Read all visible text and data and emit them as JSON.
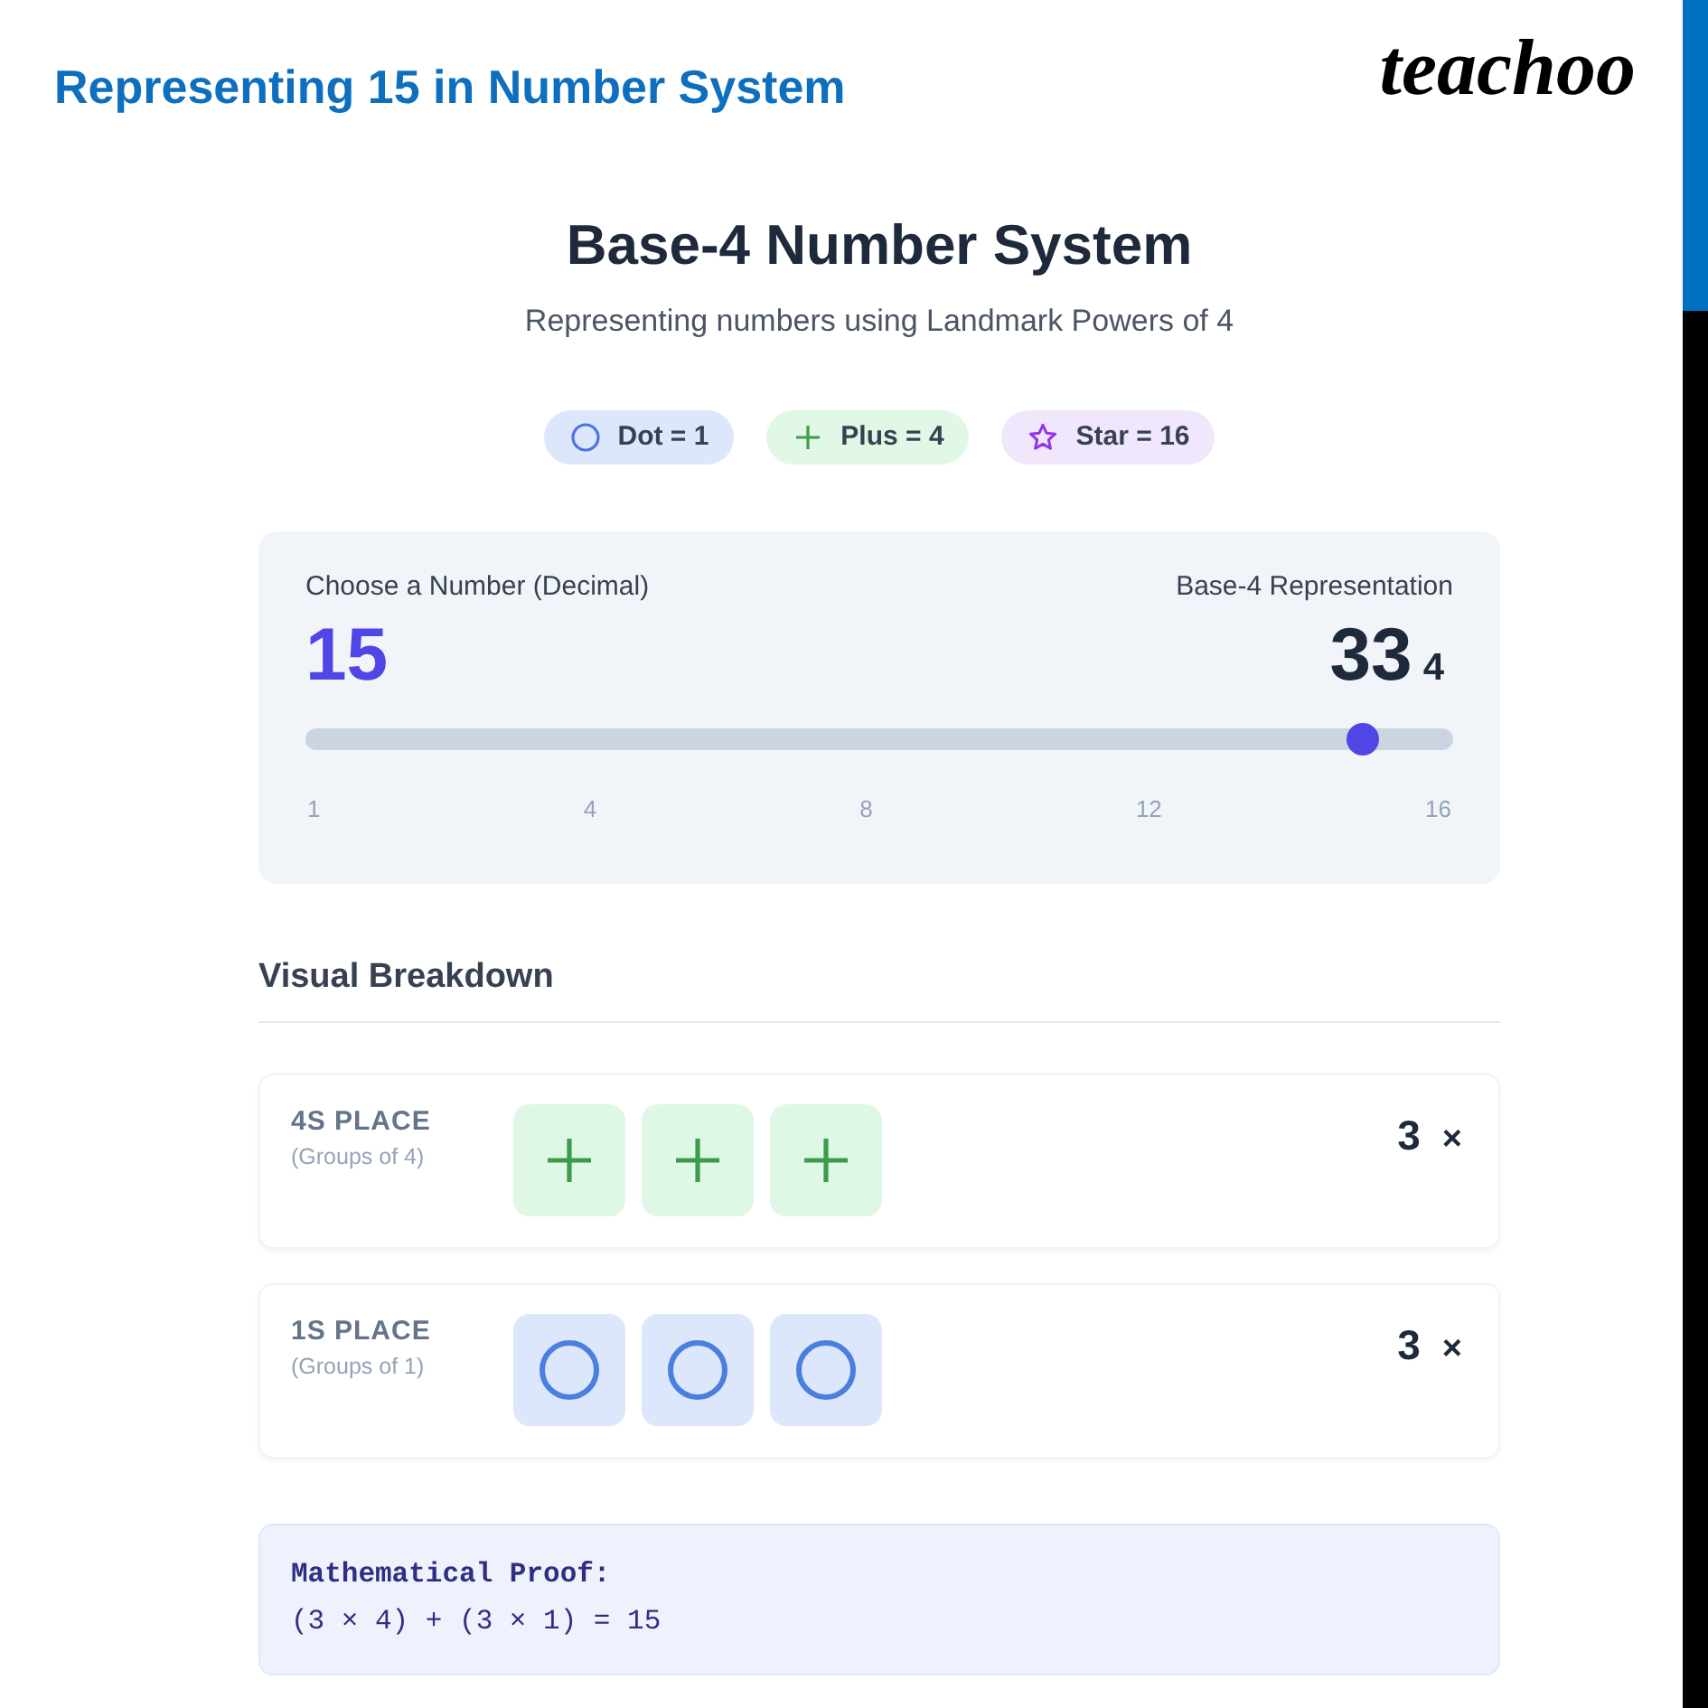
{
  "header": {
    "title": "Representing 15 in Number System",
    "logo": "teachoo"
  },
  "page": {
    "heading": "Base-4 Number System",
    "subtitle": "Representing numbers using Landmark Powers of 4"
  },
  "legend": [
    {
      "kind": "dot",
      "label": "Dot = 1"
    },
    {
      "kind": "plus",
      "label": "Plus = 4"
    },
    {
      "kind": "star",
      "label": "Star = 16"
    }
  ],
  "picker": {
    "label": "Choose a Number (Decimal)",
    "value": "15",
    "level": 0.933,
    "ticks": [
      "1",
      "4",
      "8",
      "12",
      "16"
    ],
    "representation_label": "Base-4 Representation",
    "digits": "33",
    "base": "4"
  },
  "breakdown": {
    "title": "Visual Breakdown",
    "rows": [
      {
        "title": "4S PLACE",
        "caption": "(Groups of 4)",
        "tiles": [
          {
            "kind": "plus"
          },
          {
            "kind": "plus"
          },
          {
            "kind": "plus"
          }
        ],
        "count": "3",
        "operator": "×"
      },
      {
        "title": "1S PLACE",
        "caption": "(Groups of 1)",
        "tiles": [
          {
            "kind": "dot"
          },
          {
            "kind": "dot"
          },
          {
            "kind": "dot"
          }
        ],
        "count": "3",
        "operator": "×"
      }
    ]
  },
  "proof": {
    "heading": "Mathematical Proof:",
    "equation": "(3 × 4) + (3 × 1) = 15"
  }
}
